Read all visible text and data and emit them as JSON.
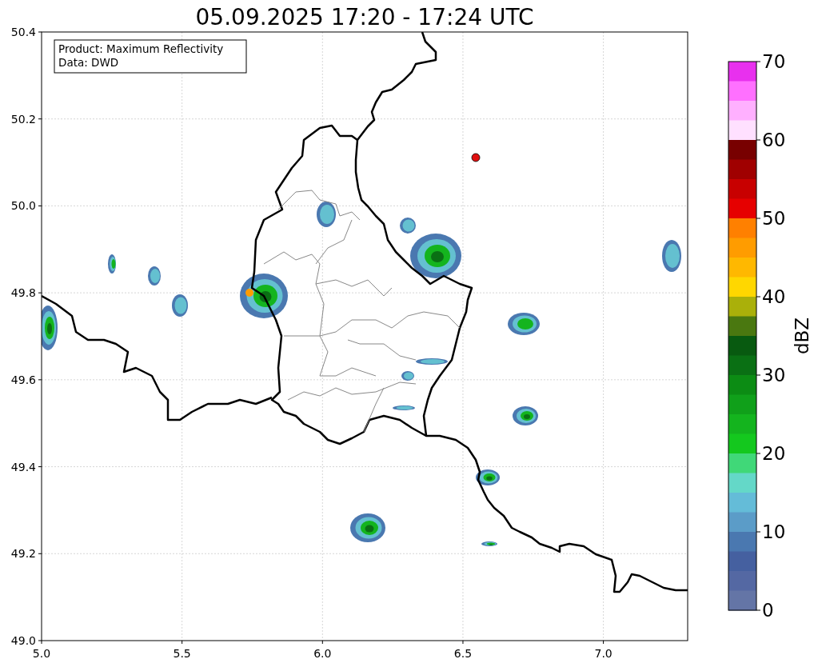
{
  "title": "05.09.2025 17:20 - 17:24 UTC",
  "info_box": [
    "Product: Maximum Reflectivity",
    "Data: DWD"
  ],
  "axes": {
    "xticks": [
      "5.0",
      "5.5",
      "6.0",
      "6.5",
      "7.0"
    ],
    "yticks": [
      "50.4",
      "50.2",
      "50.0",
      "49.8",
      "49.6",
      "49.4",
      "49.2",
      "49.0"
    ]
  },
  "colorbar": {
    "label": "dBZ",
    "ticks": [
      "70",
      "60",
      "50",
      "40",
      "30",
      "20",
      "10",
      "0"
    ],
    "segments": [
      {
        "color": "#e830ee"
      },
      {
        "color": "#ff70ff"
      },
      {
        "color": "#ffb0ff"
      },
      {
        "color": "#ffe0ff"
      },
      {
        "color": "#780000"
      },
      {
        "color": "#a00000"
      },
      {
        "color": "#c80000"
      },
      {
        "color": "#e60000"
      },
      {
        "color": "#ff8000"
      },
      {
        "color": "#ff9c00"
      },
      {
        "color": "#ffb800"
      },
      {
        "color": "#ffd700"
      },
      {
        "color": "#aab00a"
      },
      {
        "color": "#4a7810"
      },
      {
        "color": "#085a10"
      },
      {
        "color": "#0a7014"
      },
      {
        "color": "#0c8c14"
      },
      {
        "color": "#10a01a"
      },
      {
        "color": "#14b41e"
      },
      {
        "color": "#14c81e"
      },
      {
        "color": "#40d878"
      },
      {
        "color": "#64d8c8"
      },
      {
        "color": "#64bcd8"
      },
      {
        "color": "#5b9cc8"
      },
      {
        "color": "#4a78b0"
      },
      {
        "color": "#4560a0"
      },
      {
        "color": "#5468a3"
      },
      {
        "color": "#6475a6"
      }
    ]
  }
}
